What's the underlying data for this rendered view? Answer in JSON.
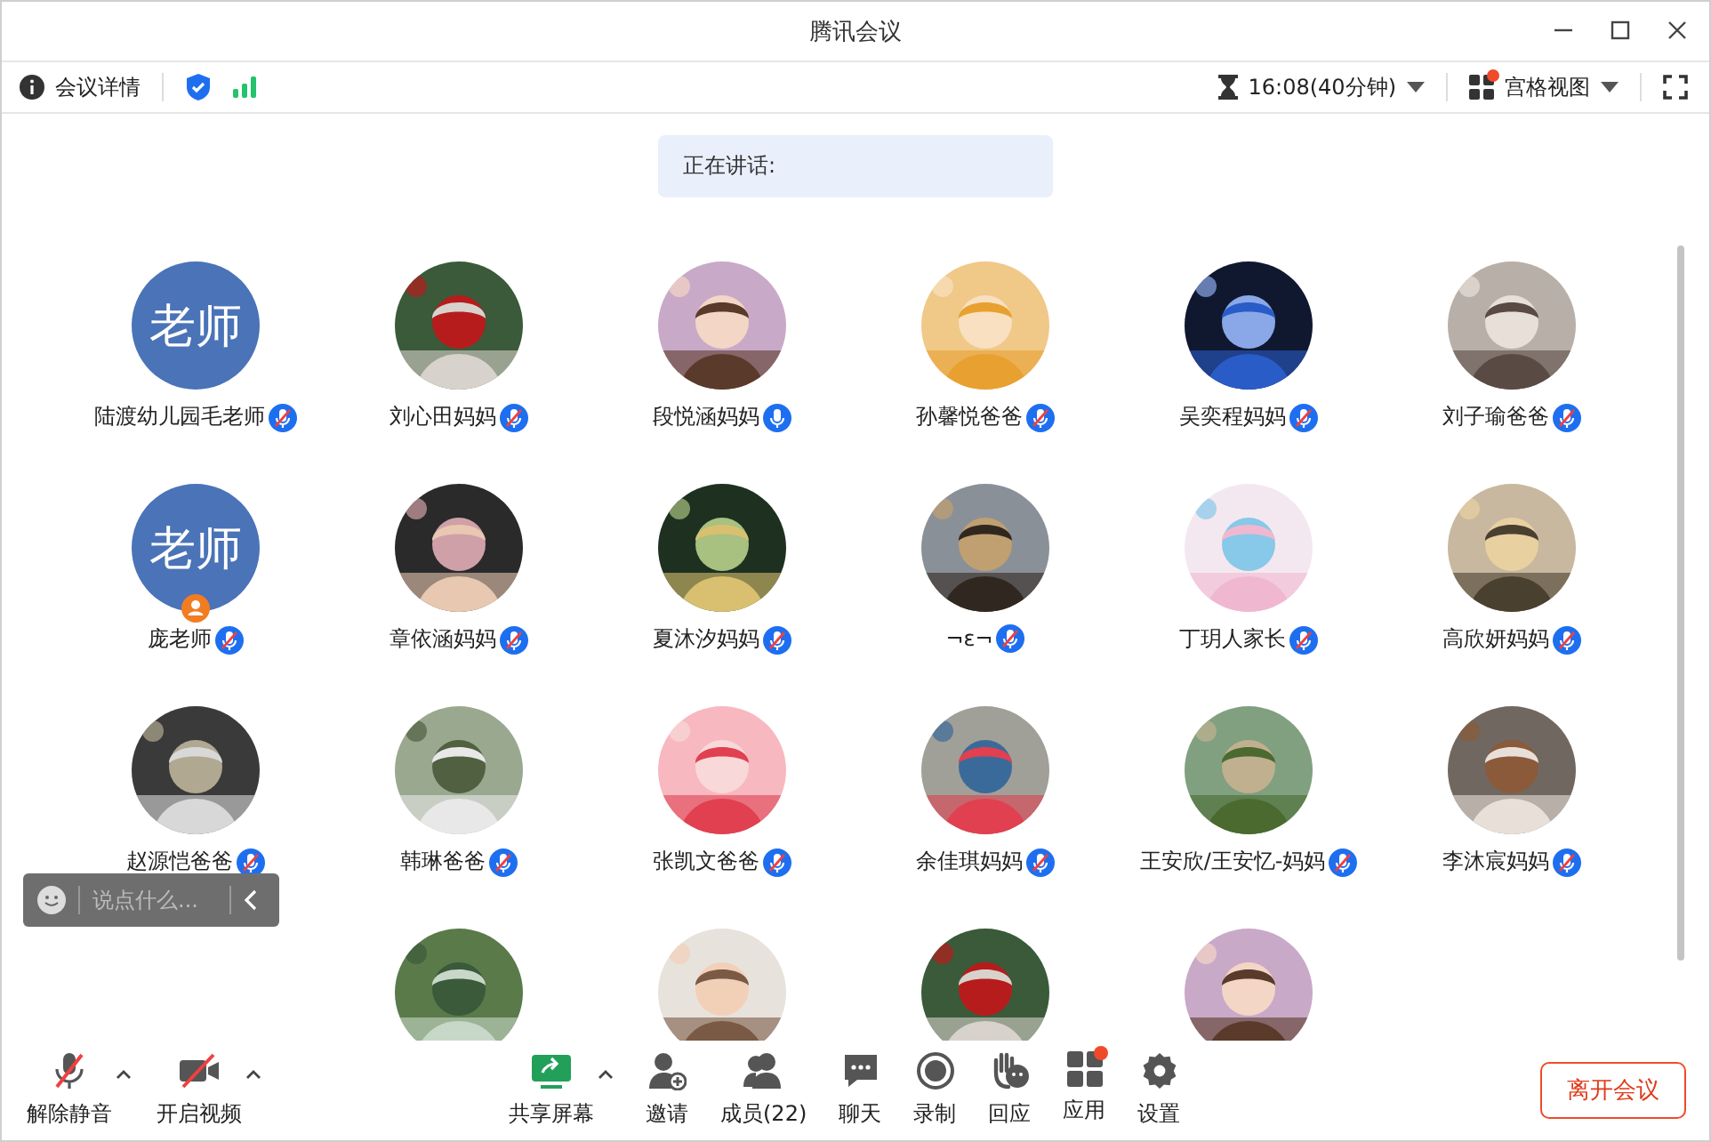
{
  "window": {
    "title": "腾讯会议"
  },
  "toolbar": {
    "details": "会议详情",
    "timer": "16:08(40分钟)",
    "view": {
      "label": "宫格视图",
      "notice": true
    }
  },
  "speaking": {
    "label": "正在讲话:"
  },
  "participants": [
    {
      "name": "陆渡幼儿园毛老师",
      "muted": true,
      "host": false,
      "avatar": {
        "kind": "text",
        "text": "老师"
      }
    },
    {
      "name": "刘心田妈妈",
      "muted": true,
      "host": false,
      "avatar": {
        "kind": "picture"
      }
    },
    {
      "name": "段悦涵妈妈",
      "muted": false,
      "host": false,
      "avatar": {
        "kind": "picture"
      }
    },
    {
      "name": "孙馨悦爸爸",
      "muted": true,
      "host": false,
      "avatar": {
        "kind": "picture"
      }
    },
    {
      "name": "吴奕程妈妈",
      "muted": true,
      "host": false,
      "avatar": {
        "kind": "picture"
      }
    },
    {
      "name": "刘子瑜爸爸",
      "muted": true,
      "host": false,
      "avatar": {
        "kind": "picture"
      }
    },
    {
      "name": "庞老师",
      "muted": true,
      "host": true,
      "avatar": {
        "kind": "text",
        "text": "老师"
      }
    },
    {
      "name": "章依涵妈妈",
      "muted": true,
      "host": false,
      "avatar": {
        "kind": "picture"
      }
    },
    {
      "name": "夏沐汐妈妈",
      "muted": true,
      "host": false,
      "avatar": {
        "kind": "picture"
      }
    },
    {
      "name": "¬ε¬",
      "muted": true,
      "host": false,
      "avatar": {
        "kind": "picture"
      }
    },
    {
      "name": "丁玥人家长",
      "muted": true,
      "host": false,
      "avatar": {
        "kind": "picture"
      }
    },
    {
      "name": "高欣妍妈妈",
      "muted": true,
      "host": false,
      "avatar": {
        "kind": "picture"
      }
    },
    {
      "name": "赵源恺爸爸",
      "muted": true,
      "host": false,
      "avatar": {
        "kind": "picture"
      }
    },
    {
      "name": "韩琳爸爸",
      "muted": true,
      "host": false,
      "avatar": {
        "kind": "picture"
      }
    },
    {
      "name": "张凯文爸爸",
      "muted": true,
      "host": false,
      "avatar": {
        "kind": "picture"
      }
    },
    {
      "name": "余佳琪妈妈",
      "muted": true,
      "host": false,
      "avatar": {
        "kind": "picture"
      }
    },
    {
      "name": "王安欣/王安忆-妈妈",
      "muted": true,
      "host": false,
      "avatar": {
        "kind": "picture"
      }
    },
    {
      "name": "李沐宸妈妈",
      "muted": true,
      "host": false,
      "avatar": {
        "kind": "picture"
      }
    },
    {
      "avatar": {
        "kind": "empty"
      }
    },
    {
      "avatar": {
        "kind": "picture"
      }
    },
    {
      "avatar": {
        "kind": "picture"
      }
    },
    {
      "avatar": {
        "kind": "picture"
      }
    },
    {
      "avatar": {
        "kind": "picture"
      }
    }
  ],
  "chat_box": {
    "placeholder": "说点什么..."
  },
  "controls": [
    {
      "kind": "mic",
      "label": "解除静音",
      "menu": true
    },
    {
      "kind": "camera",
      "label": "开启视频",
      "menu": true
    },
    {
      "kind": "share",
      "label": "共享屏幕",
      "menu": true
    },
    {
      "kind": "invite",
      "label": "邀请",
      "menu": false
    },
    {
      "kind": "members",
      "label": "成员(22)",
      "menu": false
    },
    {
      "kind": "chat",
      "label": "聊天",
      "menu": false
    },
    {
      "kind": "record",
      "label": "录制",
      "menu": false
    },
    {
      "kind": "react",
      "label": "回应",
      "menu": false
    },
    {
      "kind": "apps",
      "label": "应用",
      "menu": false
    },
    {
      "kind": "settings",
      "label": "设置",
      "menu": false
    }
  ],
  "leave_button": "离开会议"
}
